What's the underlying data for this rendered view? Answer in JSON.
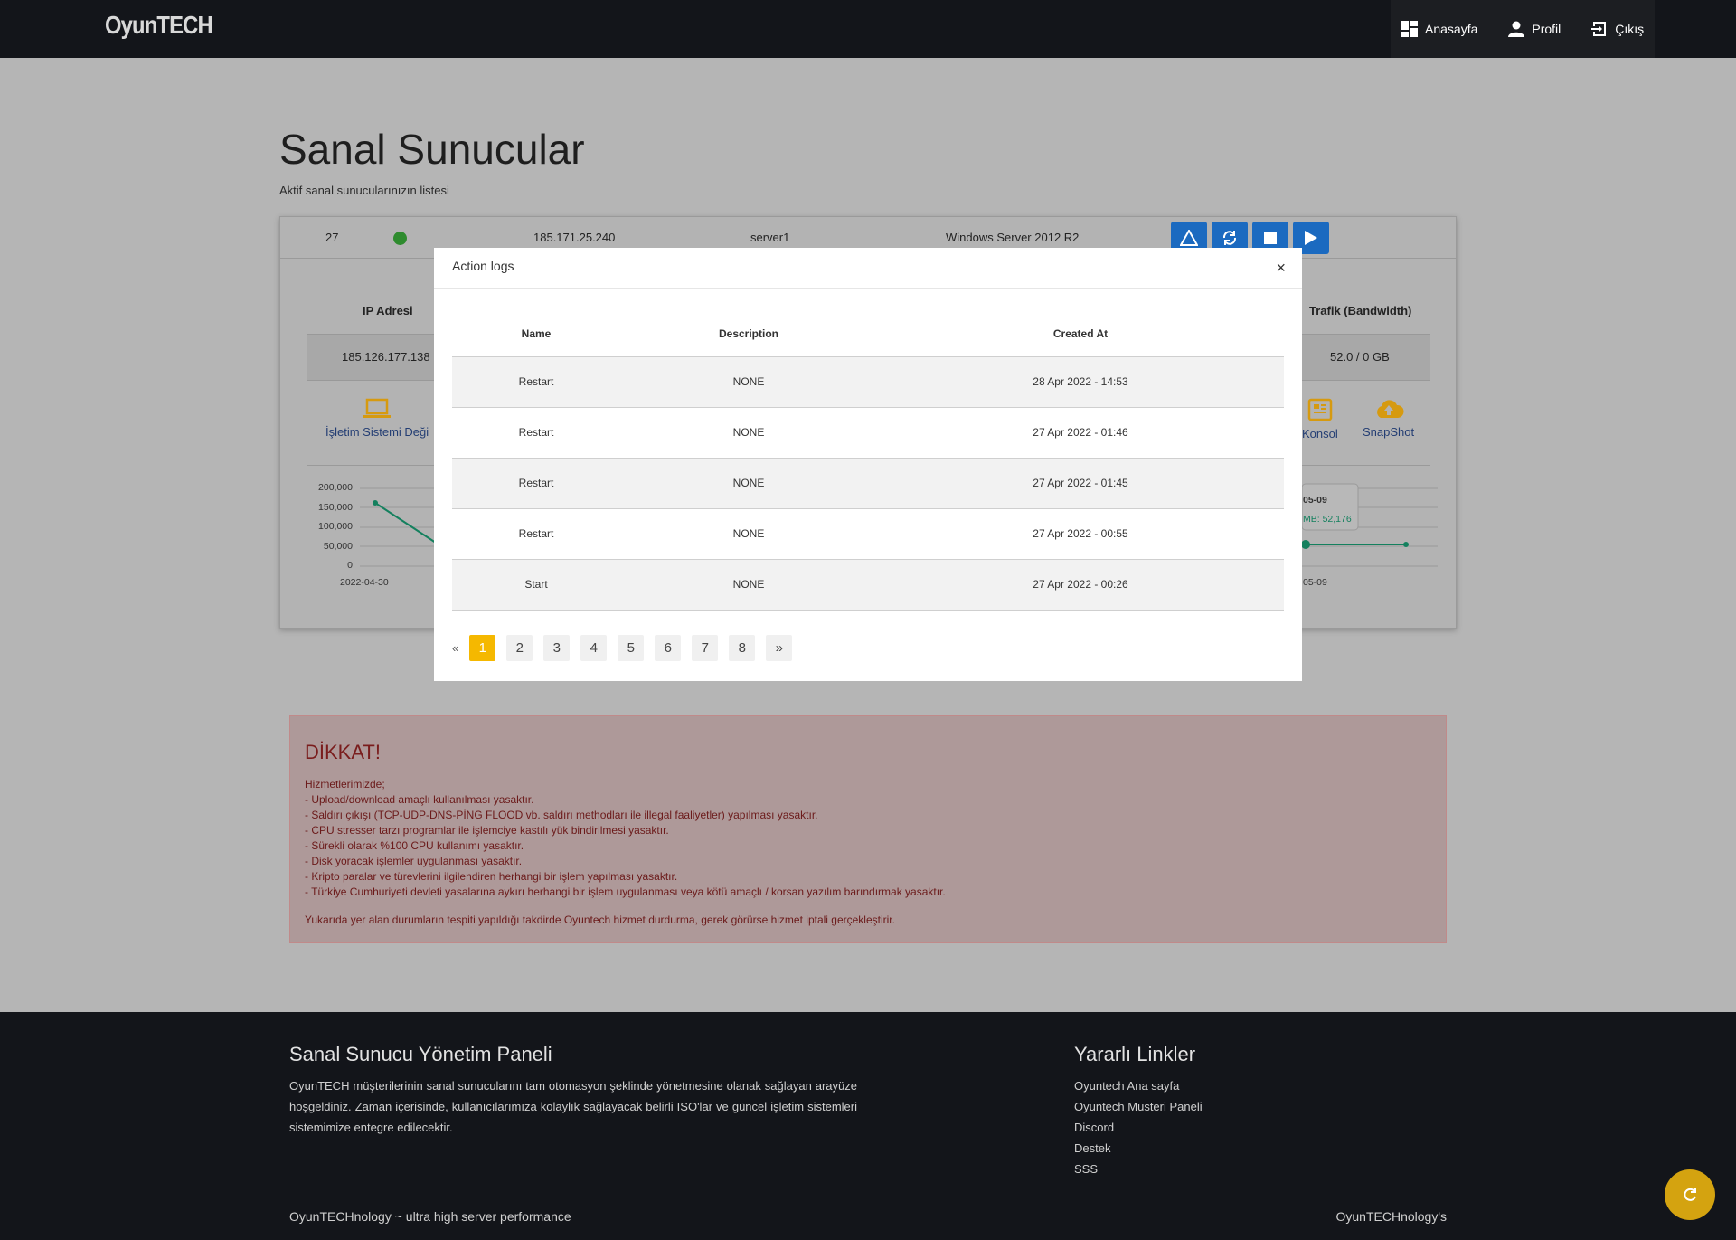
{
  "navbar": {
    "logo": "OyunTECH",
    "links": [
      {
        "label": "Anasayfa",
        "icon": "dashboard-icon"
      },
      {
        "label": "Profil",
        "icon": "user-icon"
      },
      {
        "label": "Çıkış",
        "icon": "logout-icon"
      }
    ]
  },
  "page": {
    "title": "Sanal Sunucular",
    "subtitle": "Aktif sanal sunucularınızın listesi"
  },
  "server": {
    "id": "27",
    "status_color": "#2e8b2e",
    "ip": "185.171.25.240",
    "name": "server1",
    "os": "Windows Server 2012 R2",
    "actions": [
      "warning-icon",
      "restart-icon",
      "stop-icon",
      "play-icon"
    ],
    "info_headers": {
      "ip": "IP Adresi",
      "traffic": "Trafik (Bandwidth)"
    },
    "info_values": {
      "ip": "185.126.177.138",
      "traffic": "52.0 / 0 GB"
    },
    "tools": [
      {
        "label": "İşletim Sistemi Deği",
        "icon": "laptop-icon"
      },
      {
        "label": "Konsol",
        "icon": "console-icon"
      },
      {
        "label": "SnapShot",
        "icon": "cloud-upload-icon"
      }
    ],
    "chart_left": {
      "y_ticks": [
        "200,000",
        "150,000",
        "100,000",
        "50,000",
        "0"
      ],
      "x_label": "2022-04-30"
    },
    "chart_right": {
      "tooltip_date": "05-09",
      "tooltip_value": "MB: 52,176",
      "x_label": "05-09"
    }
  },
  "modal": {
    "title": "Action logs",
    "close": "×",
    "columns": [
      "Name",
      "Description",
      "Created At"
    ],
    "rows": [
      {
        "name": "Restart",
        "description": "NONE",
        "created_at": "28 Apr 2022 - 14:53"
      },
      {
        "name": "Restart",
        "description": "NONE",
        "created_at": "27 Apr 2022 - 01:46"
      },
      {
        "name": "Restart",
        "description": "NONE",
        "created_at": "27 Apr 2022 - 01:45"
      },
      {
        "name": "Restart",
        "description": "NONE",
        "created_at": "27 Apr 2022 - 00:55"
      },
      {
        "name": "Start",
        "description": "NONE",
        "created_at": "27 Apr 2022 - 00:26"
      }
    ],
    "pagination": {
      "prev": "«",
      "next": "»",
      "pages": [
        "1",
        "2",
        "3",
        "4",
        "5",
        "6",
        "7",
        "8"
      ],
      "active": "1"
    }
  },
  "warning": {
    "title": "DİKKAT!",
    "lines": [
      "Hizmetlerimizde;",
      "- Upload/download amaçlı kullanılması yasaktır.",
      "- Saldırı çıkışı (TCP-UDP-DNS-PİNG FLOOD vb. saldırı methodları ile illegal faaliyetler) yapılması yasaktır.",
      "- CPU stresser tarzı programlar ile işlemciye kastılı yük bindirilmesi yasaktır.",
      "- Sürekli olarak %100 CPU kullanımı yasaktır.",
      "- Disk yoracak işlemler uygulanması yasaktır.",
      "- Kripto paralar ve türevlerini ilgilendiren herhangi bir işlem yapılması yasaktır.",
      "- Türkiye Cumhuriyeti devleti yasalarına aykırı herhangi bir işlem uygulanması veya kötü amaçlı / korsan yazılım barındırmak yasaktır."
    ],
    "footer": "Yukarıda yer alan durumların tespiti yapıldığı takdirde Oyuntech hizmet durdurma, gerek görürse hizmet iptali gerçekleştirir."
  },
  "footer": {
    "left_title": "Sanal Sunucu Yönetim Paneli",
    "left_text": "OyunTECH müşterilerinin sanal sunucularını tam otomasyon şeklinde yönetmesine olanak sağlayan arayüze hoşgeldiniz. Zaman içerisinde, kullanıcılarımıza kolaylık sağlayacak belirli ISO'lar ve güncel işletim sistemleri sistemimize entegre edilecektir.",
    "right_title": "Yararlı Linkler",
    "links": [
      "Oyuntech Ana sayfa",
      "Oyuntech Musteri Paneli",
      "Discord",
      "Destek",
      "SSS"
    ],
    "bottom_left": "OyunTECHnology ~ ultra high server performance",
    "bottom_right": "OyunTECHnology's"
  },
  "colors": {
    "accent": "#f5b800",
    "primary_button": "#1b6ac0",
    "navbar": "#13151a",
    "fab": "#d4a310"
  }
}
